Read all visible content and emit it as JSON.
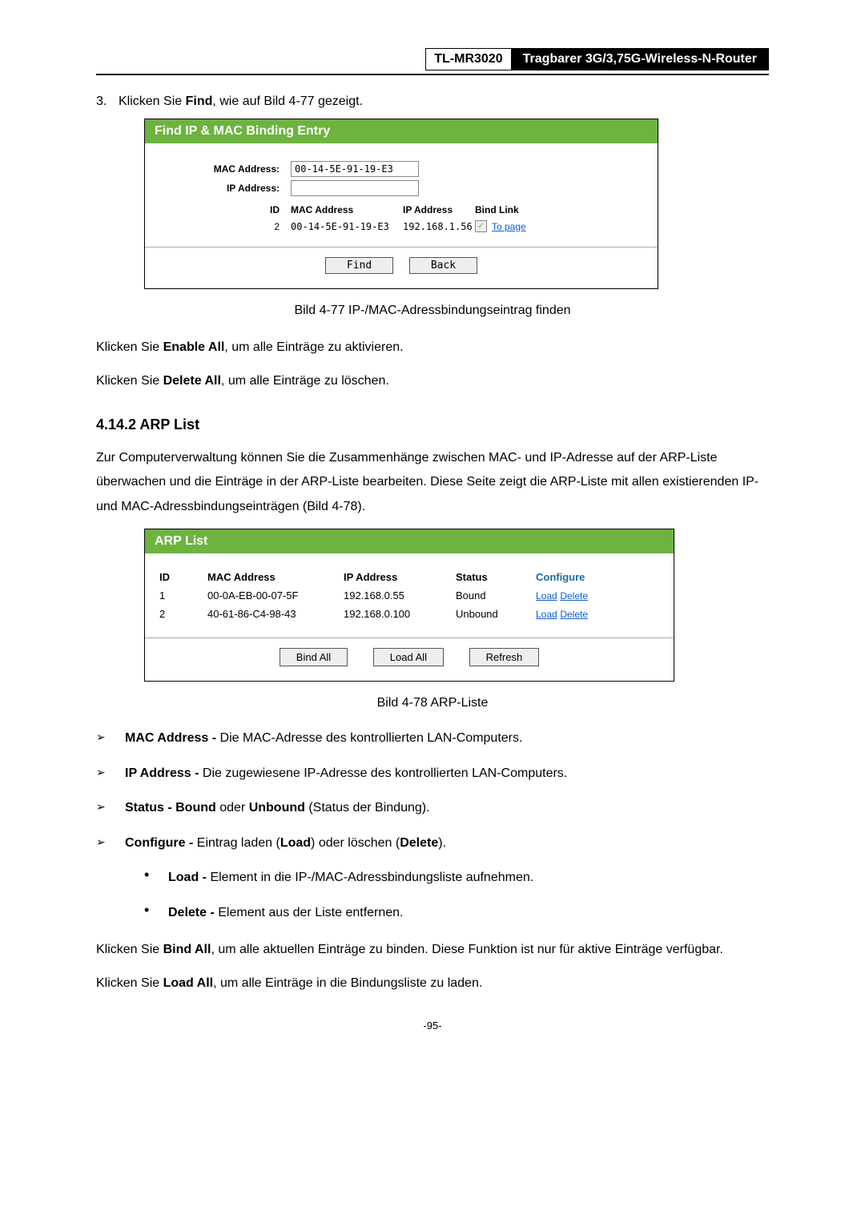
{
  "header": {
    "model": "TL-MR3020",
    "desc": "Tragbarer 3G/3,75G-Wireless-N-Router"
  },
  "step3": {
    "num": "3.",
    "pre": "Klicken Sie ",
    "bold": "Find",
    "post": ", wie auf Bild 4-77 gezeigt."
  },
  "panel1": {
    "title": "Find IP & MAC Binding Entry",
    "mac_label": "MAC Address:",
    "mac_value": "00-14-5E-91-19-E3",
    "ip_label": "IP Address:",
    "ip_value": "",
    "cols": {
      "id": "ID",
      "mac": "MAC Address",
      "ip": "IP Address",
      "bind": "Bind Link"
    },
    "row": {
      "id": "2",
      "mac": "00-14-5E-91-19-E3",
      "ip": "192.168.1.56",
      "link": "To page"
    },
    "btn_find": "Find",
    "btn_back": "Back"
  },
  "caption1": "Bild 4-77 IP-/MAC-Adressbindungseintrag finden",
  "enable_all": {
    "pre": "Klicken Sie ",
    "bold": "Enable All",
    "post": ", um alle Einträge zu aktivieren."
  },
  "delete_all": {
    "pre": "Klicken Sie ",
    "bold": "Delete All",
    "post": ", um alle Einträge zu löschen."
  },
  "section_title": "4.14.2  ARP List",
  "arp_intro": "Zur Computerverwaltung können Sie die Zusammenhänge zwischen MAC- und IP-Adresse auf der ARP-Liste überwachen und die Einträge in der ARP-Liste bearbeiten. Diese Seite zeigt die ARP-Liste mit allen existierenden IP- und MAC-Adressbindungseinträgen (Bild 4-78).",
  "panel2": {
    "title": "ARP List",
    "cols": {
      "id": "ID",
      "mac": "MAC Address",
      "ip": "IP Address",
      "status": "Status",
      "configure": "Configure"
    },
    "rows": [
      {
        "id": "1",
        "mac": "00-0A-EB-00-07-5F",
        "ip": "192.168.0.55",
        "status": "Bound",
        "load": "Load",
        "del": "Delete"
      },
      {
        "id": "2",
        "mac": "40-61-86-C4-98-43",
        "ip": "192.168.0.100",
        "status": "Unbound",
        "load": "Load",
        "del": "Delete"
      }
    ],
    "btn_bind": "Bind All",
    "btn_load": "Load All",
    "btn_refresh": "Refresh"
  },
  "caption2": "Bild 4-78 ARP-Liste",
  "defs": {
    "mac": {
      "b": "MAC Address - ",
      "t": "Die MAC-Adresse des kontrollierten LAN-Computers."
    },
    "ip": {
      "b": "IP Address - ",
      "t": "Die zugewiesene IP-Adresse des kontrollierten LAN-Computers."
    },
    "status": {
      "b1": "Status - Bound",
      "m": " oder ",
      "b2": "Unbound",
      "t": " (Status der Bindung)."
    },
    "configure": {
      "b1": "Configure - ",
      "t1": "Eintrag laden (",
      "b2": "Load",
      "t2": ") oder löschen (",
      "b3": "Delete",
      "t3": ")."
    },
    "load": {
      "b": "Load - ",
      "t": "Element in die IP-/MAC-Adressbindungsliste aufnehmen."
    },
    "delete": {
      "b": "Delete - ",
      "t": "Element aus der Liste entfernen."
    }
  },
  "bind_all_p": {
    "pre": "Klicken Sie ",
    "bold": "Bind All",
    "post": ", um alle aktuellen Einträge zu binden. Diese Funktion ist nur für aktive Einträge verfügbar."
  },
  "load_all_p": {
    "pre": "Klicken Sie ",
    "bold": "Load All",
    "post": ", um alle Einträge in die Bindungsliste zu laden."
  },
  "pageno": "-95-"
}
